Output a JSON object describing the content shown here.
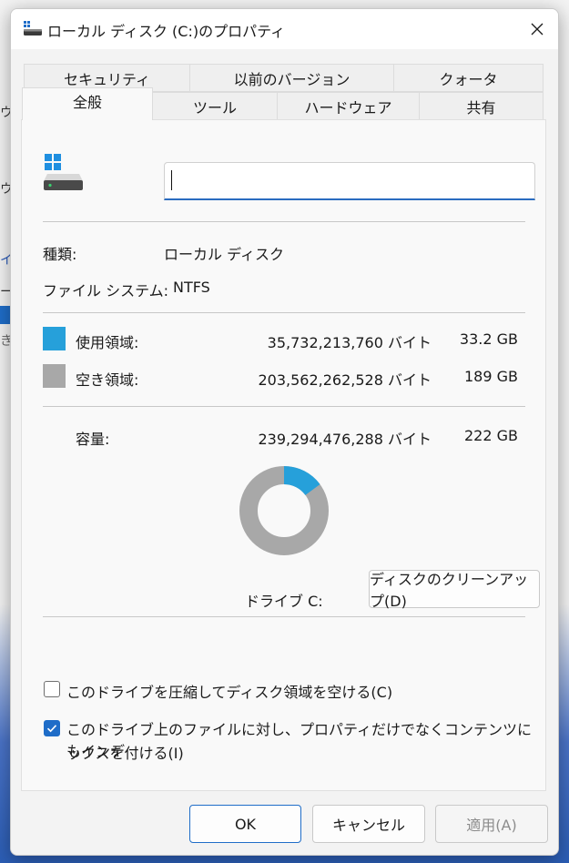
{
  "background_window": {
    "fragments": [
      "ウ",
      "ウ",
      "イ",
      "ー",
      "き"
    ]
  },
  "dialog": {
    "title": "ローカル ディスク (C:)のプロパティ",
    "tabs_row1": [
      "セキュリティ",
      "以前のバージョン",
      "クォータ"
    ],
    "tabs_row2": [
      "全般",
      "ツール",
      "ハードウェア",
      "共有"
    ],
    "active_tab": "全般"
  },
  "general": {
    "name_value": "",
    "type_label": "種類:",
    "type_value": "ローカル ディスク",
    "fs_label": "ファイル システム:",
    "fs_value": "NTFS",
    "used": {
      "label": "使用領域:",
      "bytes": "35,732,213,760 バイト",
      "size": "33.2 GB",
      "color": "#26a0da"
    },
    "free": {
      "label": "空き領域:",
      "bytes": "203,562,262,528 バイト",
      "size": "189 GB",
      "color": "#a8a8a8"
    },
    "capacity": {
      "label": "容量:",
      "bytes": "239,294,476,288 バイト",
      "size": "222 GB"
    },
    "used_fraction": 0.149,
    "drive_label": "ドライブ C:",
    "cleanup_button": "ディスクのクリーンアップ(D)",
    "compress_checkbox": {
      "label": "このドライブを圧縮してディスク領域を空ける(C)",
      "checked": false
    },
    "index_checkbox": {
      "label_line1": "このドライブ上のファイルに対し、プロパティだけでなくコンテンツにもインデ",
      "label_line2": "ックスを付ける(I)",
      "checked": true
    }
  },
  "footer": {
    "ok": "OK",
    "cancel": "キャンセル",
    "apply": "適用(A)"
  },
  "accent_color": "#1f6dc8"
}
